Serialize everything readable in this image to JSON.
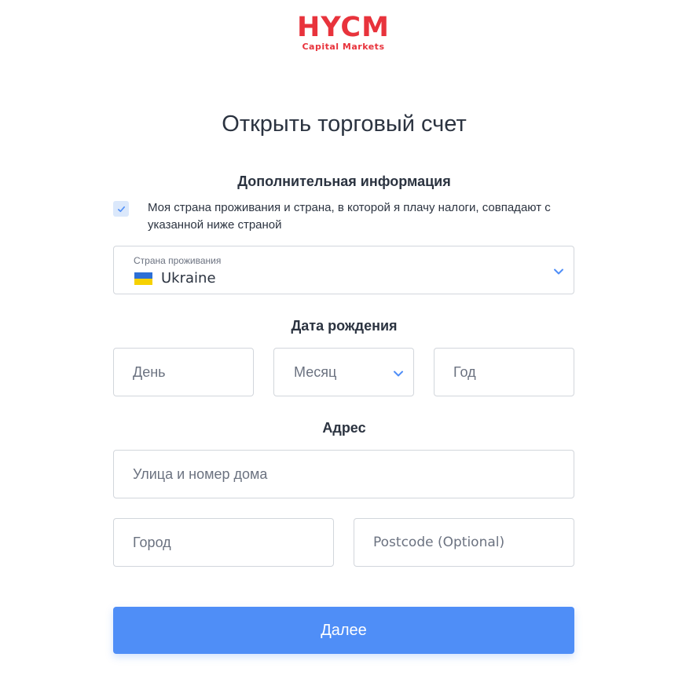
{
  "brand": {
    "name": "HYCM",
    "tagline": "Capital Markets",
    "color": "#e8333c"
  },
  "title": "Открыть торговый счет",
  "additional_info": {
    "heading": "Дополнительная информация",
    "same_tax_country_checked": true,
    "same_tax_country_label": "Моя страна проживания и страна, в которой я плачу налоги, совпадают с указанной ниже страной"
  },
  "country": {
    "caption": "Страна проживания",
    "value": "Ukraine",
    "flag_icon": "ukraine-flag-icon"
  },
  "dob": {
    "heading": "Дата рождения",
    "day_placeholder": "День",
    "month_placeholder": "Месяц",
    "year_placeholder": "Год"
  },
  "address": {
    "heading": "Адрес",
    "street_placeholder": "Улица и номер дома",
    "city_placeholder": "Город",
    "postcode_placeholder": "Postcode (Optional)"
  },
  "submit": {
    "label": "Далее",
    "color": "#4f8ef7"
  },
  "icons": {
    "select_chevron": "chevron-down-icon",
    "checkbox_mark": "checkmark-icon"
  }
}
